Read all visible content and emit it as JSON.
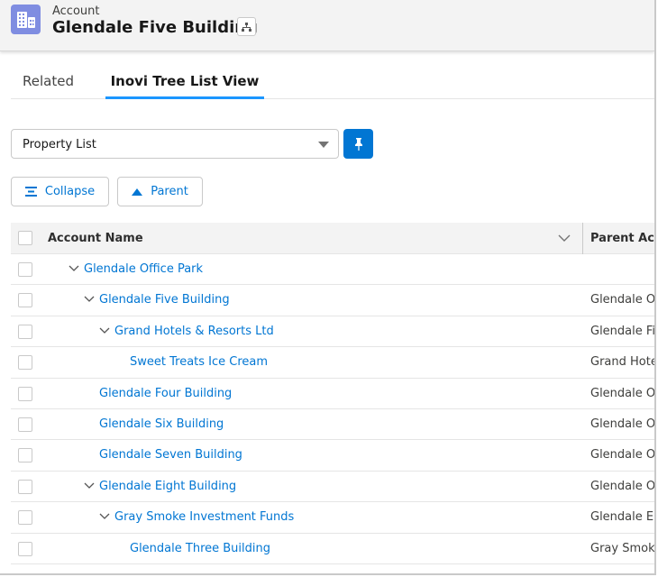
{
  "header": {
    "object_label": "Account",
    "title": "Glendale Five Building",
    "icon": "building-icon",
    "hierarchy_icon": "hierarchy-icon",
    "icon_color": "#7f8de1"
  },
  "tabs": [
    {
      "label": "Related",
      "active": false
    },
    {
      "label": "Inovi Tree List View",
      "active": true
    }
  ],
  "list_select": {
    "value": "Property List"
  },
  "pin_button": {
    "icon": "pin-icon",
    "color": "#0176d3"
  },
  "buttons": {
    "collapse": "Collapse",
    "parent": "Parent"
  },
  "table": {
    "columns": [
      "Account Name",
      "Parent Acco"
    ],
    "rows": [
      {
        "name": "Glendale Office Park",
        "level": 0,
        "expanded": true,
        "parent": ""
      },
      {
        "name": "Glendale Five Building",
        "level": 1,
        "expanded": true,
        "parent": "Glendale Off"
      },
      {
        "name": "Grand Hotels & Resorts Ltd",
        "level": 2,
        "expanded": true,
        "parent": "Glendale Fiv"
      },
      {
        "name": "Sweet Treats Ice Cream",
        "level": 3,
        "expanded": null,
        "parent": "Grand Hotels"
      },
      {
        "name": "Glendale Four Building",
        "level": 1,
        "expanded": null,
        "parent": "Glendale Off"
      },
      {
        "name": "Glendale Six Building",
        "level": 1,
        "expanded": null,
        "parent": "Glendale Off"
      },
      {
        "name": "Glendale Seven Building",
        "level": 1,
        "expanded": null,
        "parent": "Glendale Off"
      },
      {
        "name": "Glendale Eight Building",
        "level": 1,
        "expanded": true,
        "parent": "Glendale Off"
      },
      {
        "name": "Gray Smoke Investment Funds",
        "level": 2,
        "expanded": true,
        "parent": "Glendale Eig"
      },
      {
        "name": "Glendale Three Building",
        "level": 3,
        "expanded": null,
        "parent": "Gray Smoke"
      }
    ]
  }
}
